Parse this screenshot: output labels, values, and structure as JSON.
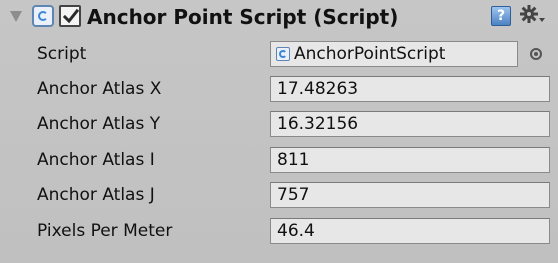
{
  "component": {
    "title": "Anchor Point Script (Script)",
    "enabled": true
  },
  "script_row": {
    "label": "Script",
    "value": "AnchorPointScript"
  },
  "fields": [
    {
      "label": "Anchor Atlas X",
      "value": "17.48263"
    },
    {
      "label": "Anchor Atlas Y",
      "value": "16.32156"
    },
    {
      "label": "Anchor Atlas I",
      "value": "811"
    },
    {
      "label": "Anchor Atlas J",
      "value": "757"
    },
    {
      "label": "Pixels Per Meter",
      "value": "46.4"
    }
  ],
  "icons": {
    "foldout": "foldout-triangle-icon",
    "component": "script-icon",
    "help": "help-icon",
    "settings": "gear-icon",
    "picker": "object-picker-icon"
  }
}
